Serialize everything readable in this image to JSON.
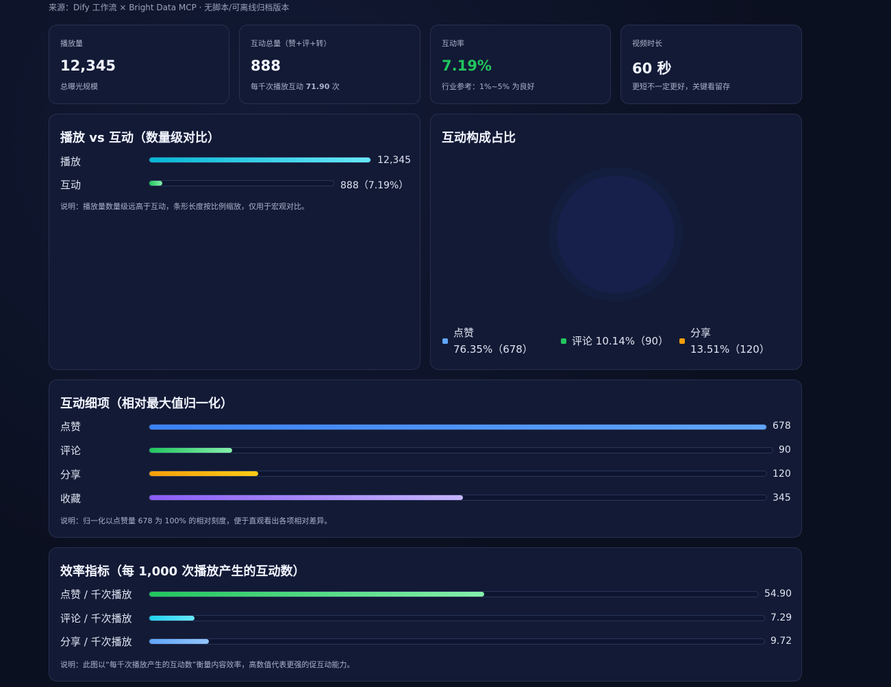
{
  "source": "来源：Dify 工作流 × Bright Data MCP · 无脚本/可离线归档版本",
  "kpis": [
    {
      "label": "播放量",
      "value": "12,345",
      "sub": "总曝光规模"
    },
    {
      "label": "互动总量（赞+评+转）",
      "value": "888",
      "sub_prefix": "每千次播放互动 ",
      "sub_strong": "71.90",
      "sub_suffix": " 次"
    },
    {
      "label": "互动率",
      "value": "7.19%",
      "sub": "行业参考：1%~5% 为良好",
      "value_color": "#22c55e"
    },
    {
      "label": "视频时长",
      "value": "60 秒",
      "sub": "更短不一定更好，关键看留存"
    }
  ],
  "play_vs_interact": {
    "title": "播放 vs 互动（数量级对比）",
    "rows": [
      {
        "label": "播放",
        "value_text": "12,345",
        "ratio": 1.0,
        "colors": [
          "#06b6d4",
          "#67e8f9"
        ]
      },
      {
        "label": "互动",
        "value_text": "888（7.19%）",
        "ratio": 0.0719,
        "colors": [
          "#22c55e",
          "#86efac"
        ]
      }
    ],
    "note": "说明：播放量数量级远高于互动，条形长度按比例缩放，仅用于宏观对比。"
  },
  "composition": {
    "title": "互动构成占比",
    "legend": [
      {
        "name": "点赞",
        "detail": "76.35%（678）",
        "color": "#60a5fa"
      },
      {
        "name": "评论",
        "detail": "10.14%（90）",
        "color": "#22c55e"
      },
      {
        "name": "分享",
        "detail": "13.51%（120）",
        "color": "#f59e0b"
      }
    ]
  },
  "details": {
    "title": "互动细项（相对最大值归一化）",
    "rows": [
      {
        "label": "点赞",
        "value": 678,
        "colors": [
          "#3b82f6",
          "#60a5fa"
        ]
      },
      {
        "label": "评论",
        "value": 90,
        "colors": [
          "#22c55e",
          "#86efac"
        ]
      },
      {
        "label": "分享",
        "value": 120,
        "colors": [
          "#f59e0b",
          "#facc15"
        ]
      },
      {
        "label": "收藏",
        "value": 345,
        "colors": [
          "#8b5cf6",
          "#c4b5fd"
        ]
      }
    ],
    "note": "说明：归一化以点赞量 678 为 100% 的相对刻度，便于直观看出各项相对差异。"
  },
  "efficiency": {
    "title": "效率指标（每 1,000 次播放产生的互动数）",
    "rows": [
      {
        "label": "点赞 / 千次播放",
        "value_text": "54.90",
        "ratio": 0.55,
        "colors": [
          "#22c55e",
          "#86efac"
        ]
      },
      {
        "label": "评论 / 千次播放",
        "value_text": "7.29",
        "ratio": 0.073,
        "colors": [
          "#22d3ee",
          "#67e8f9"
        ]
      },
      {
        "label": "分享 / 千次播放",
        "value_text": "9.72",
        "ratio": 0.097,
        "colors": [
          "#60a5fa",
          "#93c5fd"
        ]
      }
    ],
    "note": "说明：此图以“每千次播放产生的互动数”衡量内容效率，高数值代表更强的促互动能力。"
  }
}
